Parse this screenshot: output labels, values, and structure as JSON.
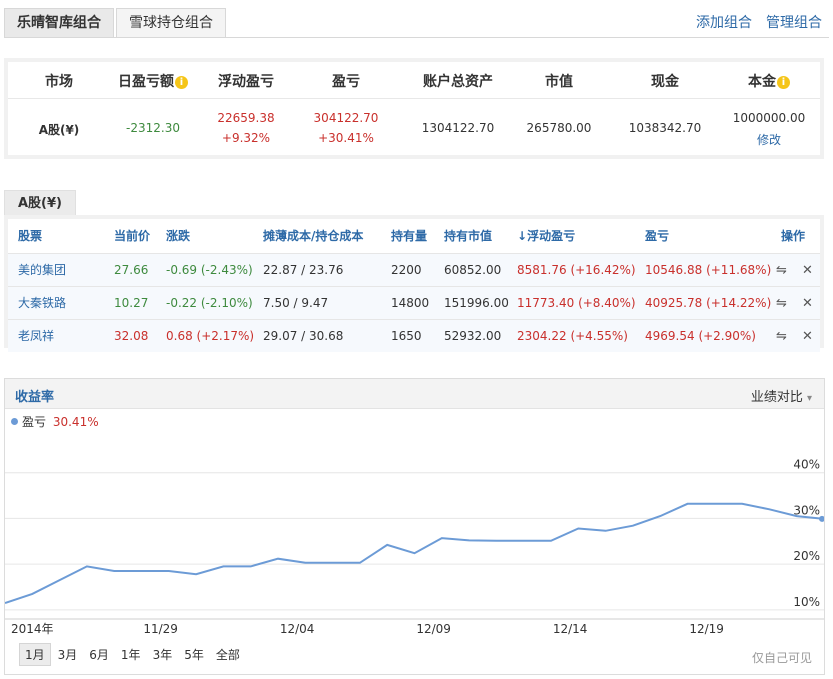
{
  "tabs": [
    "乐晴智库组合",
    "雪球持仓组合"
  ],
  "top_links": {
    "add": "添加组合",
    "manage": "管理组合"
  },
  "summary": {
    "headers": [
      "市场",
      "日盈亏额",
      "浮动盈亏",
      "盈亏",
      "账户总资产",
      "市值",
      "现金",
      "本金"
    ],
    "info_glyph": "i",
    "market": "A股(¥)",
    "daily_pnl": "-2312.30",
    "float_pnl": "22659.38",
    "float_pnl_pct": "+9.32%",
    "pnl": "304122.70",
    "pnl_pct": "+30.41%",
    "total_assets": "1304122.70",
    "market_value": "265780.00",
    "cash": "1038342.70",
    "principal": "1000000.00",
    "edit": "修改"
  },
  "holdings": {
    "tab": "A股(¥)",
    "headers": [
      "股票",
      "当前价",
      "涨跌",
      "摊薄成本/持仓成本",
      "持有量",
      "持有市值",
      "浮动盈亏",
      "盈亏",
      "操作"
    ],
    "sort_glyph": "↓",
    "rows": [
      {
        "name": "美的集团",
        "price": "27.66",
        "change": "-0.69 (-2.43%)",
        "cost": "22.87 / 23.76",
        "qty": "2200",
        "value": "60852.00",
        "float": "8581.76 (+16.42%)",
        "pnl": "10546.88 (+11.68%)",
        "trend": "down"
      },
      {
        "name": "大秦铁路",
        "price": "10.27",
        "change": "-0.22 (-2.10%)",
        "cost": "7.50 / 9.47",
        "qty": "14800",
        "value": "151996.00",
        "float": "11773.40 (+8.40%)",
        "pnl": "40925.78 (+14.22%)",
        "trend": "down"
      },
      {
        "name": "老凤祥",
        "price": "32.08",
        "change": "0.68 (+2.17%)",
        "cost": "29.07 / 30.68",
        "qty": "1650",
        "value": "52932.00",
        "float": "2304.22 (+4.55%)",
        "pnl": "4969.54 (+2.90%)",
        "trend": "up"
      }
    ],
    "action_icons": [
      "transfer-icon",
      "close-icon"
    ],
    "action_glyphs": [
      "⇋",
      "✕"
    ]
  },
  "chart_panel": {
    "title": "收益率",
    "compare": "业绩对比",
    "compare_glyph": "▾",
    "legend_name": "盈亏",
    "legend_value": "30.41%",
    "ranges": [
      "1月",
      "3月",
      "6月",
      "1年",
      "3年",
      "5年",
      "全部"
    ],
    "selected_range": "1月",
    "private": "仅自己可见"
  },
  "colors": {
    "line": "#6c9bd6",
    "up": "#c9302c",
    "down": "#3e8a3e",
    "link": "#2e6aa7"
  },
  "chart_data": {
    "type": "line",
    "series": [
      {
        "name": "盈亏",
        "values": [
          11.5,
          13.5,
          16.5,
          19.5,
          18.5,
          18.5,
          18.5,
          17.8,
          19.5,
          19.5,
          21.2,
          20.3,
          20.3,
          20.3,
          24.2,
          22.4,
          25.7,
          25.2,
          25.1,
          25.1,
          25.1,
          27.8,
          27.3,
          28.4,
          30.5,
          33.2,
          33.2,
          33.2,
          32.0,
          30.5,
          29.9
        ]
      }
    ],
    "x_tick_labels": [
      "2014年",
      "11/29",
      "12/04",
      "12/09",
      "12/14",
      "12/19"
    ],
    "x_tick_index": [
      0,
      5.7,
      10.7,
      15.7,
      20.7,
      25.7
    ],
    "y_ticks": [
      10,
      20,
      30,
      40
    ],
    "y_tick_labels": [
      "10%",
      "20%",
      "30%",
      "40%"
    ],
    "ylim": [
      8,
      50
    ],
    "grid": true,
    "legend": "top-left"
  }
}
